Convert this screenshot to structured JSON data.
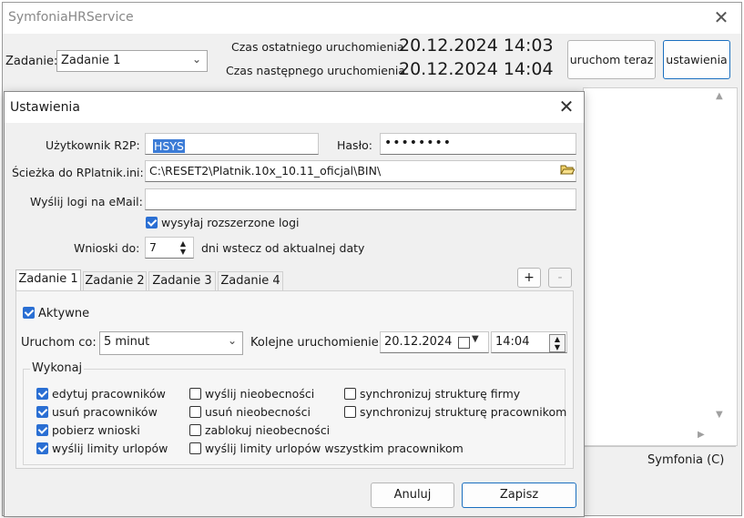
{
  "main": {
    "title": "SymfoniaHRService",
    "close_glyph": "✕",
    "task_label": "Zadanie:",
    "task_value": "Zadanie 1",
    "last_run_label": "Czas ostatniego uruchomienia",
    "last_run_value": "20.12.2024 14:03",
    "next_run_label": "Czas następnego uruchomienia",
    "next_run_value": "20.12.2024 14:04",
    "run_now_label": "uruchom teraz",
    "settings_label": "ustawienia",
    "status_text": "Symfonia (C)"
  },
  "dialog": {
    "title": "Ustawienia",
    "close_glyph": "✕",
    "user_label": "Użytkownik R2P:",
    "user_value": "HSYS",
    "password_label": "Hasło:",
    "password_value": "••••••••",
    "path_label": "Ścieżka do RPlatnik.ini:",
    "path_value": "C:\\RESET2\\Platnik.10x_10.11_oficjal\\BIN\\",
    "email_label": "Wyślij logi na eMail:",
    "email_value": "",
    "extended_logs_label": "wysyłaj rozszerzone logi",
    "extended_logs_checked": true,
    "requests_label": "Wnioski do:",
    "requests_value": "7",
    "requests_suffix": "dni wstecz od aktualnej daty",
    "tabs": [
      {
        "label": "Zadanie 1",
        "active": true
      },
      {
        "label": "Zadanie 2",
        "active": false
      },
      {
        "label": "Zadanie 3",
        "active": false
      },
      {
        "label": "Zadanie 4",
        "active": false
      }
    ],
    "add_tab_label": "+",
    "remove_tab_label": "-",
    "task": {
      "active_label": "Aktywne",
      "active_checked": true,
      "run_every_label": "Uruchom co:",
      "run_every_value": "5 minut",
      "next_launch_label": "Kolejne uruchomienie:",
      "next_launch_date": "20.12.2024",
      "next_launch_time": "14:04",
      "execute_label": "Wykonaj",
      "options": {
        "edit_employees": {
          "label": "edytuj pracowników",
          "checked": true
        },
        "delete_employees": {
          "label": "usuń pracowników",
          "checked": true
        },
        "get_requests": {
          "label": "pobierz wnioski",
          "checked": true
        },
        "send_leave_limits": {
          "label": "wyślij limity urlopów",
          "checked": true
        },
        "send_absences": {
          "label": "wyślij nieobecności",
          "checked": false
        },
        "delete_absences": {
          "label": "usuń nieobecności",
          "checked": false
        },
        "lock_absences": {
          "label": "zablokuj nieobecności",
          "checked": false
        },
        "send_limits_all": {
          "label": "wyślij limity urlopów wszystkim pracownikom",
          "checked": false
        },
        "sync_company_structure": {
          "label": "synchronizuj strukturę firmy",
          "checked": false
        },
        "sync_employee_structure": {
          "label": "synchronizuj strukturę pracownikom",
          "checked": false
        }
      }
    },
    "cancel_label": "Anuluj",
    "save_label": "Zapisz"
  },
  "icons": {
    "dropdown": "chevron-down-icon",
    "folder": "folder-icon",
    "calendar": "calendar-icon",
    "spinner": "spin-updown-icon"
  },
  "colors": {
    "accent": "#2a6fd3",
    "selection": "#3b7bd6",
    "window_bg": "#f0f0f0"
  }
}
